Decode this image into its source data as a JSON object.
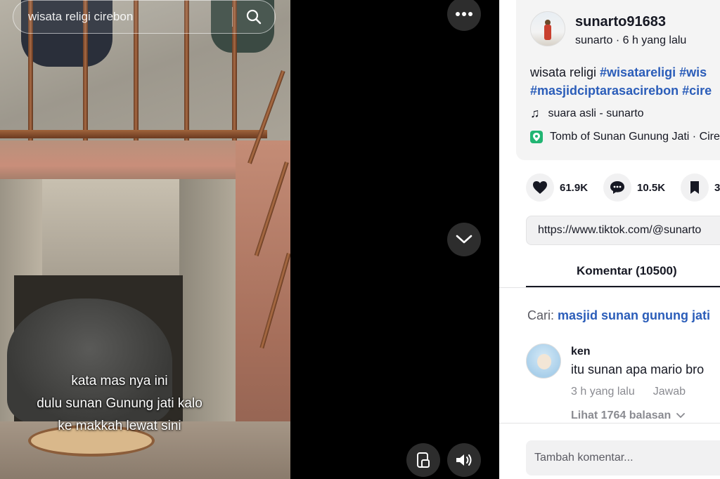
{
  "search": {
    "query": "wisata religi cirebon",
    "icon": "search-icon"
  },
  "video": {
    "caption_lines": [
      "kata mas nya ini",
      "dulu sunan Gunung jati kalo",
      "ke makkah lewat sini"
    ]
  },
  "post": {
    "username": "sunarto91683",
    "nickname": "sunarto",
    "separator": " · ",
    "posted_time": "6 h yang lalu",
    "description_text": "wisata religi ",
    "hashtags": [
      "#wisatareligi",
      "#wis",
      "#masjidciptarasacirebon",
      "#cire"
    ],
    "music": "suara asli - sunarto",
    "location": "Tomb of Sunan Gunung Jati · Cire"
  },
  "stats": {
    "likes": "61.9K",
    "comments": "10.5K",
    "saves": "3"
  },
  "share_link": "https://www.tiktok.com/@sunarto",
  "tabs": {
    "comments_label": "Komentar (10500)"
  },
  "suggest": {
    "label": "Cari: ",
    "query": "masjid sunan gunung jati"
  },
  "comment": {
    "user": "ken",
    "text": "itu sunan apa mario bro",
    "time": "3 h yang lalu",
    "reply_label": "Jawab",
    "view_replies": "Lihat 1764 balasan"
  },
  "add_comment_placeholder": "Tambah komentar...",
  "colors": {
    "hashtag": "#2b5db9",
    "text": "#161823",
    "muted": "#8a8b91",
    "location_badge": "#22b573"
  }
}
